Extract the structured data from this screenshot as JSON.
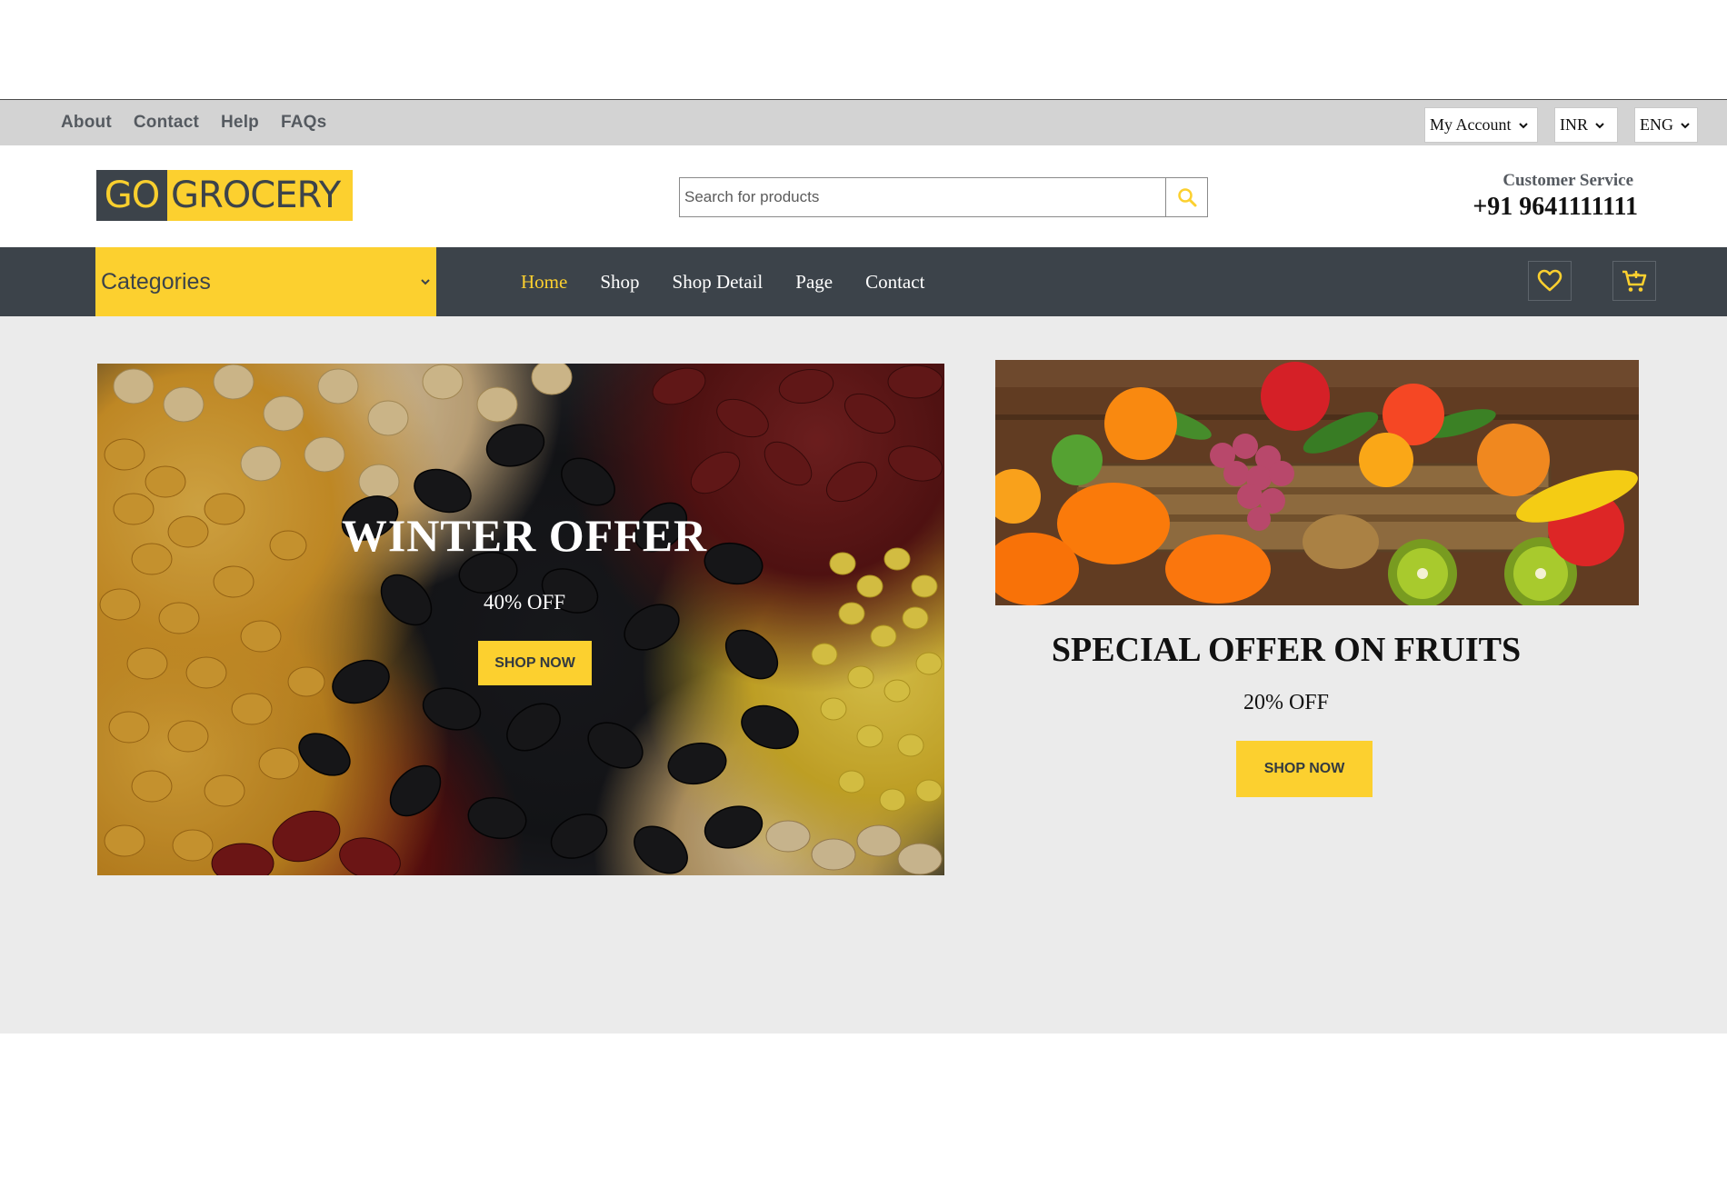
{
  "topbar": {
    "links": [
      "About",
      "Contact",
      "Help",
      "FAQs"
    ],
    "account_select": "My Account",
    "currency_select": "INR",
    "language_select": "ENG"
  },
  "header": {
    "logo_go": "GO",
    "logo_grocery": "GROCERY",
    "search_placeholder": "Search for products",
    "customer_service_label": "Customer Service",
    "customer_service_phone": "+91 9641111111"
  },
  "nav": {
    "categories_label": "Categories",
    "links": [
      "Home",
      "Shop",
      "Shop Detail",
      "Page",
      "Contact"
    ],
    "active": "Home"
  },
  "hero": {
    "winter": {
      "title": "WINTER OFFER",
      "discount": "40% OFF",
      "button": "SHOP NOW"
    },
    "fruits": {
      "title": "SPECIAL OFFER ON FRUITS",
      "discount": "20% OFF",
      "button": "SHOP NOW"
    }
  },
  "colors": {
    "accent": "#fcd02f",
    "dark": "#3c434a",
    "topbar": "#d3d3d3",
    "main_bg": "#ebebeb"
  }
}
